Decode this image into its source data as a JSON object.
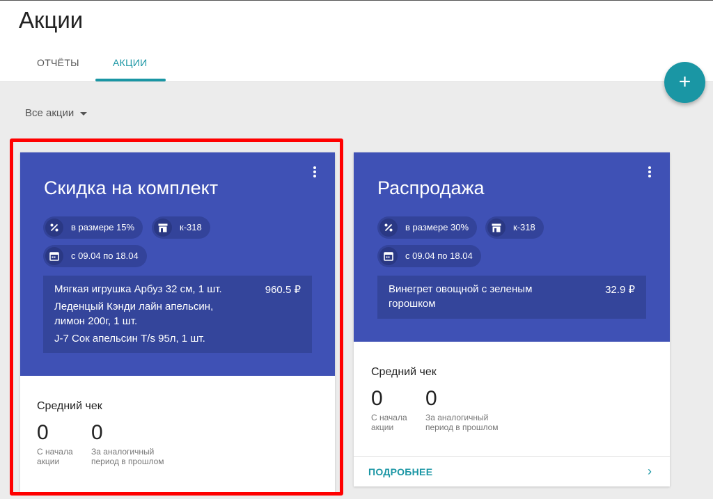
{
  "header": {
    "title": "Акции",
    "tabs": [
      {
        "label": "ОТЧЁТЫ",
        "active": false
      },
      {
        "label": "АКЦИИ",
        "active": true
      }
    ],
    "add_button": {
      "icon": "plus-icon",
      "label": "+"
    }
  },
  "filter": {
    "selected": "Все акции"
  },
  "colors": {
    "accent": "#1a96a4",
    "card_header": "#3f51b5",
    "highlight": "#ff0000"
  },
  "cards": [
    {
      "title": "Скидка на комплект",
      "chips": {
        "discount": "в размере 15%",
        "store": "к-318",
        "dates": "с 09.04 по 18.04"
      },
      "products": {
        "line1": "Мягкая игрушка Арбуз 32 см, 1 шт.",
        "line2": "Леденцый Кэнди лайн апельсин,",
        "line3": "лимон 200г, 1 шт.",
        "line4": "J-7 Сок апельсин T/s 95л, 1 шт.",
        "price": "960.5 ₽"
      },
      "stats": {
        "title": "Средний чек",
        "since_start_value": "0",
        "since_start_label_1": "С начала",
        "since_start_label_2": "акции",
        "prev_period_value": "0",
        "prev_period_label_1": "За аналогичный",
        "prev_period_label_2": "период в прошлом"
      }
    },
    {
      "title": "Распродажа",
      "chips": {
        "discount": "в размере 30%",
        "store": "к-318",
        "dates": "с 09.04 по 18.04"
      },
      "products": {
        "line1": "Винегрет овощной с зеленым",
        "line2": "горошком",
        "price": "32.9 ₽"
      },
      "stats": {
        "title": "Средний чек",
        "since_start_value": "0",
        "since_start_label_1": "С начала",
        "since_start_label_2": "акции",
        "prev_period_value": "0",
        "prev_period_label_1": "За аналогичный",
        "prev_period_label_2": "период в прошлом"
      },
      "more_label": "ПОДРОБНЕЕ"
    }
  ]
}
